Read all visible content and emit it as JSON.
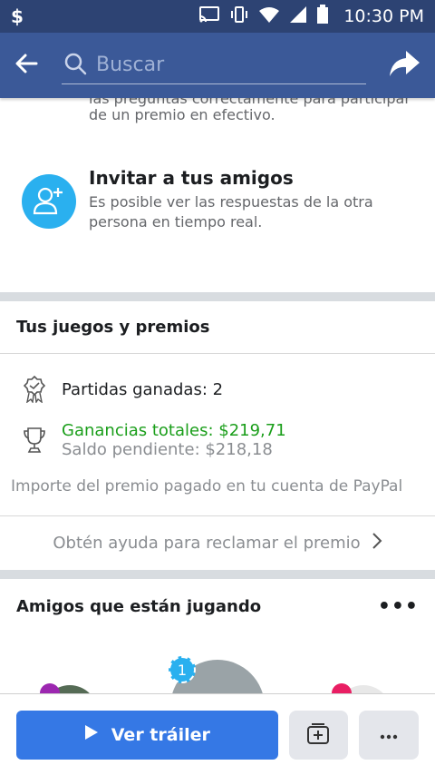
{
  "status": {
    "carrier": "$",
    "time": "10:30 PM"
  },
  "appbar": {
    "search_placeholder": "Buscar"
  },
  "intro": {
    "partial_line": "las preguntas correctamente para participar",
    "second_line": "de un premio en efectivo."
  },
  "invite": {
    "title": "Invitar a tus amigos",
    "description": "Es posible ver las respuestas de la otra persona en tiempo real."
  },
  "games": {
    "title": "Tus juegos y premios",
    "wins": "Partidas ganadas: 2",
    "earnings": "Ganancias totales: $219,71",
    "pending": "Saldo pendiente: $218,18",
    "paypal_note": "Importe del premio pagado en tu cuenta de PayPal",
    "help_link": "Obtén ayuda para reclamar el premio"
  },
  "friends": {
    "title": "Amigos que están jugando",
    "more": "•••",
    "badge": "1"
  },
  "bottom": {
    "trailer_label": "Ver tráiler"
  },
  "colors": {
    "brand": "#3b5998",
    "status": "#2d4373",
    "accent": "#3578e5",
    "earnings": "#1a9e1a"
  }
}
